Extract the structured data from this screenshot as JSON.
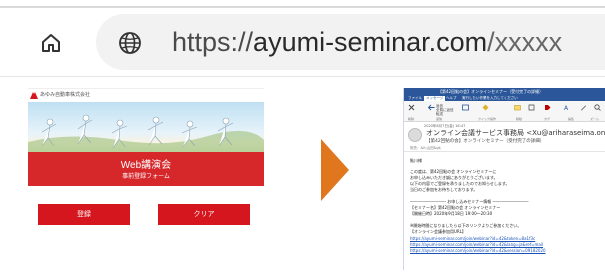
{
  "browser": {
    "home_icon": "home-icon",
    "secure_icon": "globe-icon",
    "url_scheme": "https://",
    "url_domain": "ayumi-seminar.com",
    "url_path": "/xxxxx"
  },
  "registration_page": {
    "company": "あゆみ自動車株式会社",
    "title": "Web講演会",
    "subtitle": "事前登録フォーム",
    "register_button": "登録",
    "clear_button": "クリア"
  },
  "arrow": {
    "color": "#e0771f"
  },
  "email": {
    "window_title": "【第42回鮎の会】オンラインセミナー（受付完了の詳細）",
    "tabs": [
      "ファイル",
      "メッセージ",
      "ヘルプ",
      "実行したい作業を入力してください"
    ],
    "ribbon": {
      "delete_group": "削除",
      "respond_group": "返信",
      "quick_steps_group": "クイック操作",
      "move_group": "移動",
      "tags_group": "タグ",
      "edit_group": "編集",
      "zoom_group": "ズーム",
      "reply": "返信",
      "reply_all": "全員に返信",
      "forward": "転送"
    },
    "date": "2020年8月7日(金) 16:47",
    "sender": "オンライン会議サービス事務局 <Xu@ariharaseima.onmicro",
    "subject": "【第42回鮎の会】オンラインセミナー（受付完了の詳細）",
    "to": "宛先：&lt;山田&gt;",
    "body": [
      "鮎川様",
      "この度は、第42回鮎の会 オンラインセミナーに",
      "お申し込みいただき誠にありがとうございます。",
      "以下の内容でご登録を承りましたのでお知らせします。",
      "当日のご参加をお待ちしております。",
      "――――――――― お申し込みセミナー情報 ―――――――――",
      "【セミナー名】第42回鮎の会 オンラインセミナー",
      "【開催日時】2020年9月18日 19:00〜20:30",
      "※開始時間になりましたら以下のリンクよりご参加ください。",
      "【オンライン会議参加用URL】"
    ],
    "links": [
      "https://ayumi-seminar.com/join/webinar?id=42&token=8a1f3c",
      "https://ayumi-seminar.com/join/webinar?id=42&lang=ja&ref=mail",
      "https://ayumi-seminar.com/join/webinar?id=42&session=09182020"
    ]
  }
}
